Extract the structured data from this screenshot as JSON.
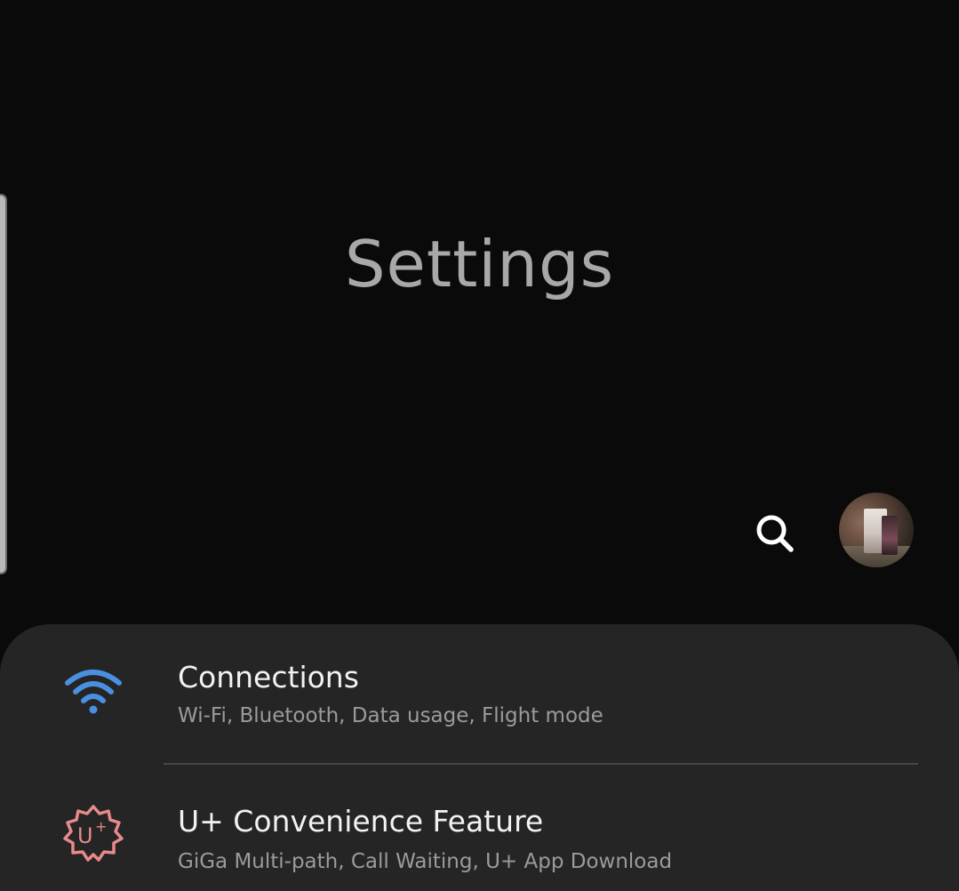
{
  "header": {
    "title": "Settings"
  },
  "toolbar": {
    "search_icon": "search-icon",
    "avatar_icon": "profile-avatar"
  },
  "menu": {
    "items": [
      {
        "icon": "wifi-icon",
        "icon_color": "#4a90e2",
        "title": "Connections",
        "subtitle": "Wi-Fi, Bluetooth, Data usage, Flight mode"
      },
      {
        "icon": "uplus-gear-icon",
        "icon_color": "#e88a8a",
        "title": "U+ Convenience Feature",
        "subtitle": "GiGa Multi-path, Call Waiting, U+ App Download"
      }
    ]
  },
  "colors": {
    "background": "#0a0a0a",
    "card": "#252525",
    "title": "#a8a8a8",
    "subtitle": "#9b9b9b"
  }
}
